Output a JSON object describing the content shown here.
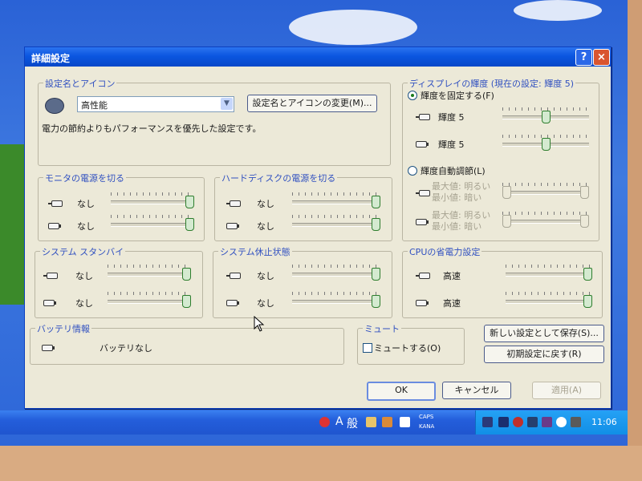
{
  "dialog": {
    "title": "詳細設定",
    "help_btn": "?",
    "close_btn": "×"
  },
  "scheme": {
    "group_label": "設定名とアイコン",
    "select_value": "高性能",
    "change_button": "設定名とアイコンの変更(M)...",
    "description": "電力の節約よりもパフォーマンスを優先した設定です。"
  },
  "monitor": {
    "group_label": "モニタの電源を切る",
    "ac_value": "なし",
    "dc_value": "なし",
    "ac_level": 1.0,
    "dc_level": 1.0
  },
  "harddisk": {
    "group_label": "ハードディスクの電源を切る",
    "ac_value": "なし",
    "dc_value": "なし",
    "ac_level": 1.0,
    "dc_level": 1.0
  },
  "standby": {
    "group_label": "システム スタンバイ",
    "ac_value": "なし",
    "dc_value": "なし",
    "ac_level": 1.0,
    "dc_level": 1.0
  },
  "hibernate": {
    "group_label": "システム休止状態",
    "ac_value": "なし",
    "dc_value": "なし",
    "ac_level": 1.0,
    "dc_level": 1.0
  },
  "display": {
    "group_label": "ディスプレイの輝度 (現在の設定: 輝度 5)",
    "fixed_radio": "輝度を固定する(F)",
    "ac_label": "輝度 5",
    "dc_label": "輝度 5",
    "ac_level": 0.5,
    "dc_level": 0.5,
    "auto_radio": "輝度自動調節(L)",
    "auto_ac_max": "最大値: 明るい",
    "auto_ac_min": "最小値: 暗い",
    "auto_dc_max": "最大値: 明るい",
    "auto_dc_min": "最小値: 暗い"
  },
  "cpu": {
    "group_label": "CPUの省電力設定",
    "ac_value": "高速",
    "dc_value": "高速",
    "ac_level": 1.0,
    "dc_level": 1.0
  },
  "battery": {
    "group_label": "バッテリ情報",
    "status": "バッテリなし"
  },
  "mute": {
    "group_label": "ミュート",
    "checkbox_label": "ミュートする(O)"
  },
  "buttons": {
    "save_new": "新しい設定として保存(S)...",
    "reset": "初期設定に戻す(R)",
    "ok": "OK",
    "cancel": "キャンセル",
    "apply": "適用(A)"
  },
  "taskbar": {
    "ime_mode": "A",
    "ime_kanji": "般",
    "caps": "CAPS",
    "kana": "KANA",
    "clock": "11:06"
  },
  "colors": {
    "group_label": "#3050c0",
    "title_bar": "#0b56e0",
    "slider_thumb": "#d4ead0"
  }
}
